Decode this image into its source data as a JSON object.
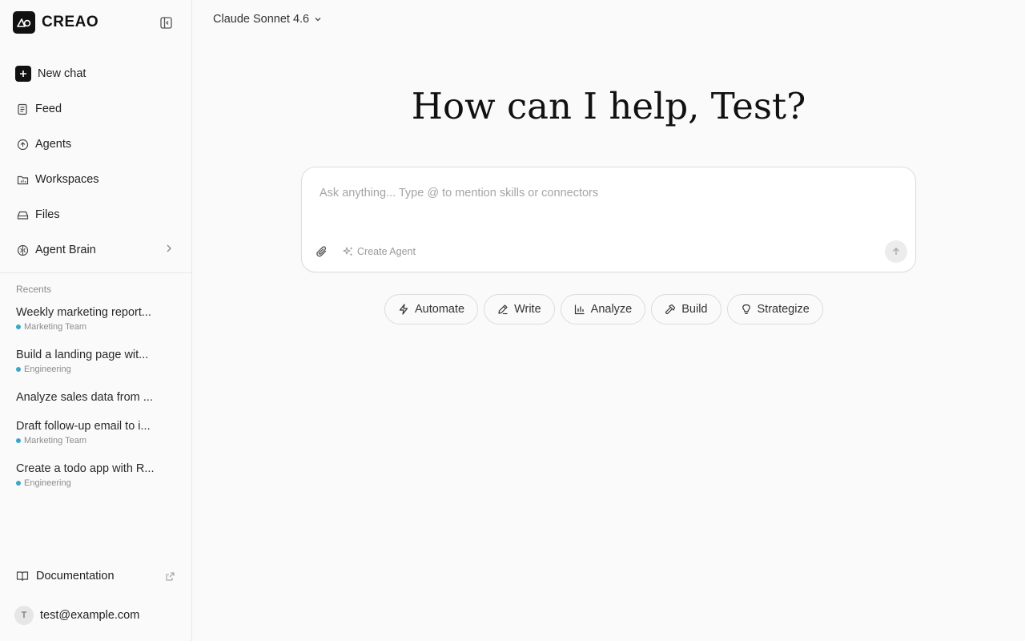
{
  "brand": {
    "name": "CREAO"
  },
  "nav": {
    "new_chat": "New chat",
    "feed": "Feed",
    "agents": "Agents",
    "workspaces": "Workspaces",
    "files": "Files",
    "agent_brain": "Agent Brain"
  },
  "recents": {
    "label": "Recents",
    "items": [
      {
        "title": "Weekly marketing report...",
        "tag": "Marketing Team"
      },
      {
        "title": "Build a landing page wit...",
        "tag": "Engineering"
      },
      {
        "title": "Analyze sales data from ...",
        "tag": ""
      },
      {
        "title": "Draft follow-up email to i...",
        "tag": "Marketing Team"
      },
      {
        "title": "Create a todo app with R...",
        "tag": "Engineering"
      }
    ]
  },
  "footer": {
    "documentation": "Documentation",
    "user_initial": "T",
    "user_email": "test@example.com"
  },
  "header": {
    "model": "Claude Sonnet 4.6"
  },
  "main": {
    "headline": "How can I help, Test?",
    "composer_placeholder": "Ask anything... Type @ to mention skills or connectors",
    "create_agent": "Create Agent"
  },
  "chips": [
    "Automate",
    "Write",
    "Analyze",
    "Build",
    "Strategize"
  ],
  "colors": {
    "tag_dot": "#3aa6c9",
    "brand_bg": "#111111"
  }
}
